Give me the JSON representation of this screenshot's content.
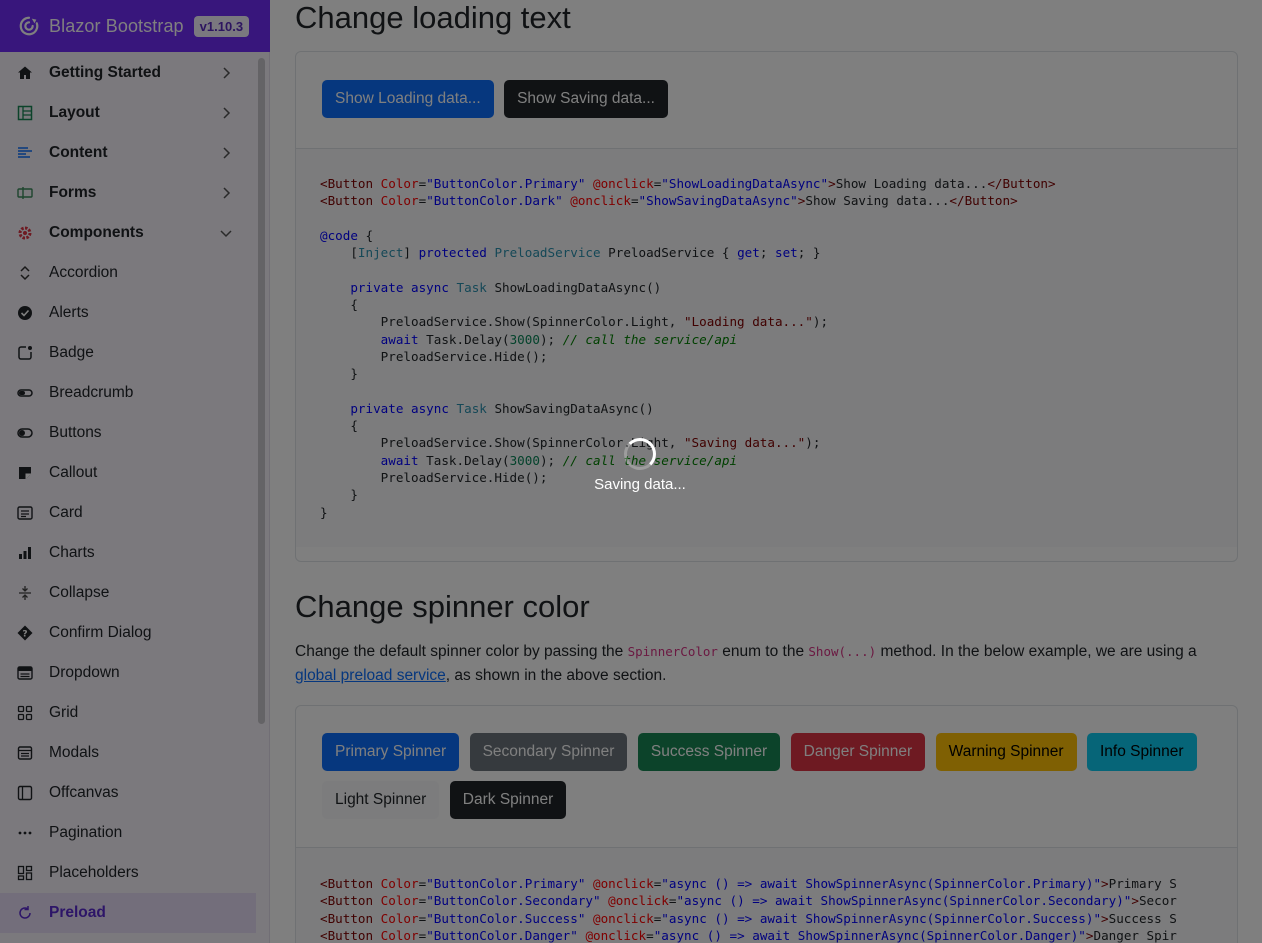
{
  "brand": {
    "name": "Blazor Bootstrap",
    "version": "v1.10.3",
    "color": "#712cf9"
  },
  "sidebar": {
    "items": [
      {
        "label": "Getting Started",
        "icon": "house-icon",
        "parent": true,
        "chevron": "right"
      },
      {
        "label": "Layout",
        "icon": "layout-icon",
        "parent": true,
        "chevron": "right"
      },
      {
        "label": "Content",
        "icon": "text-lines-icon",
        "parent": true,
        "chevron": "right"
      },
      {
        "label": "Forms",
        "icon": "input-cursor-icon",
        "parent": true,
        "chevron": "right"
      },
      {
        "label": "Components",
        "icon": "gear-icon",
        "parent": true,
        "chevron": "down"
      },
      {
        "label": "Accordion",
        "icon": "chevron-expand-icon"
      },
      {
        "label": "Alerts",
        "icon": "check-circle-icon"
      },
      {
        "label": "Badge",
        "icon": "app-indicator-icon"
      },
      {
        "label": "Breadcrumb",
        "icon": "breadcrumb-icon"
      },
      {
        "label": "Buttons",
        "icon": "toggle-icon"
      },
      {
        "label": "Callout",
        "icon": "sticky-note-icon"
      },
      {
        "label": "Card",
        "icon": "card-text-icon"
      },
      {
        "label": "Charts",
        "icon": "bar-chart-icon"
      },
      {
        "label": "Collapse",
        "icon": "arrows-collapse-icon"
      },
      {
        "label": "Confirm Dialog",
        "icon": "question-diamond-icon"
      },
      {
        "label": "Dropdown",
        "icon": "menu-button-icon"
      },
      {
        "label": "Grid",
        "icon": "grid-icon"
      },
      {
        "label": "Modals",
        "icon": "window-stack-icon"
      },
      {
        "label": "Offcanvas",
        "icon": "layout-sidebar-icon"
      },
      {
        "label": "Pagination",
        "icon": "three-dots-icon"
      },
      {
        "label": "Placeholders",
        "icon": "placeholder-grid-icon"
      },
      {
        "label": "Preload",
        "icon": "arrow-clockwise-icon",
        "active": true
      }
    ]
  },
  "section1": {
    "title": "Change loading text",
    "buttons": [
      "Show Loading data...",
      "Show Saving data..."
    ]
  },
  "section2": {
    "title": "Change spinner color",
    "desc_1": "Change the default spinner color by passing the ",
    "desc_code_1": "SpinnerColor",
    "desc_2": " enum to the ",
    "desc_code_2": "Show(...)",
    "desc_3": " method. In the below example, we are using a ",
    "desc_link": "global preload service",
    "desc_4": ", as shown in the above section.",
    "buttons": [
      "Primary Spinner",
      "Secondary Spinner",
      "Success Spinner",
      "Danger Spinner",
      "Warning Spinner",
      "Info Spinner",
      "Light Spinner",
      "Dark Spinner"
    ]
  },
  "preload": {
    "text": "Saving data..."
  },
  "colors": {
    "primary": "#0d6efd",
    "dark": "#212529",
    "secondary": "#6c757d",
    "success": "#198754",
    "danger": "#dc3545",
    "warning": "#ffc107",
    "info": "#0dcaf0",
    "light": "#f8f9fa",
    "overlay": "rgba(0,0,0,0.5)"
  }
}
